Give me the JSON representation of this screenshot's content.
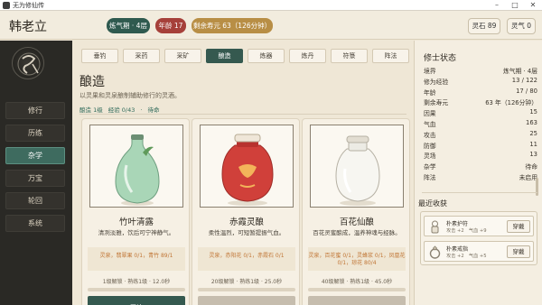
{
  "window": {
    "title": "无为修仙传",
    "minimize": "–",
    "maximize": "□",
    "close": "✕"
  },
  "header": {
    "name": "韩老立",
    "realm": "炼气期 · 4层",
    "age": "年龄 17",
    "lifespan": "剩余寿元 63（126分钟）",
    "stone_label": "灵石 89",
    "qi_label": "灵气 0"
  },
  "sidebar": {
    "items": [
      {
        "label": "修行",
        "active": false
      },
      {
        "label": "历练",
        "active": false
      },
      {
        "label": "杂学",
        "active": true
      },
      {
        "label": "万宝",
        "active": false
      },
      {
        "label": "轮回",
        "active": false
      },
      {
        "label": "系统",
        "active": false
      }
    ]
  },
  "tabs": [
    "垂钓",
    "采药",
    "采矿",
    "酿造",
    "炼器",
    "炼丹",
    "符箓",
    "阵法"
  ],
  "active_tab": "酿造",
  "section": {
    "title": "酿造",
    "description": "以灵果和灵泉酿制辅助修行的灵酒。",
    "level": "酿造 1级",
    "exp": "经验 0/43",
    "separator": "·",
    "status": "待命"
  },
  "cards": [
    {
      "name": "竹叶清露",
      "desc": "清冽淡雅，饮后可宁神静气。",
      "req1": "灵泉，翡翠果 0/1，青竹 89/1",
      "req2": "",
      "meta": "1级解锁 · 熟练1级 · 12.0秒",
      "button": "开始",
      "available": true,
      "color": "#a8d8b4"
    },
    {
      "name": "赤霞灵酿",
      "desc": "柔性温烈，可短暂提振气血。",
      "req1": "灵泉，赤阳花 0/1，赤霞石 0/1",
      "req2": "",
      "meta": "20级解锁 · 熟练1级 · 25.0秒",
      "button": "",
      "available": false,
      "color": "#d2443a"
    },
    {
      "name": "百花仙酿",
      "desc": "百花灵蜜酿成，温养神魂与经脉。",
      "req1": "灵泉，百花蜜 0/1，灵蜂浆 0/1，凤凰花",
      "req2": "0/1，琼花 80/4",
      "meta": "40级解锁 · 熟练1级 · 45.0秒",
      "button": "",
      "available": false,
      "color": "#f5f5f0"
    }
  ],
  "cultivator": {
    "title": "修士状态",
    "stats": [
      {
        "k": "境界",
        "v": "炼气期 · 4层"
      },
      {
        "k": "修为经验",
        "v": "13 / 122"
      },
      {
        "k": "年龄",
        "v": "17 / 80"
      },
      {
        "k": "剩余寿元",
        "v": "63 年（126分钟）"
      },
      {
        "k": "因果",
        "v": "15"
      },
      {
        "k": "气血",
        "v": "163"
      },
      {
        "k": "攻击",
        "v": "25"
      },
      {
        "k": "防御",
        "v": "11"
      },
      {
        "k": "灵场",
        "v": "13"
      },
      {
        "k": "杂学",
        "v": "待命"
      },
      {
        "k": "阵法",
        "v": "未启用"
      }
    ]
  },
  "harvest": {
    "title": "最近收获",
    "items": [
      {
        "name": "朴素护符",
        "stats": "攻击 +2　气血 +9",
        "button": "穿戴"
      },
      {
        "name": "朴素戒指",
        "stats": "攻击 +2　气血 +5",
        "button": "穿戴"
      }
    ]
  }
}
